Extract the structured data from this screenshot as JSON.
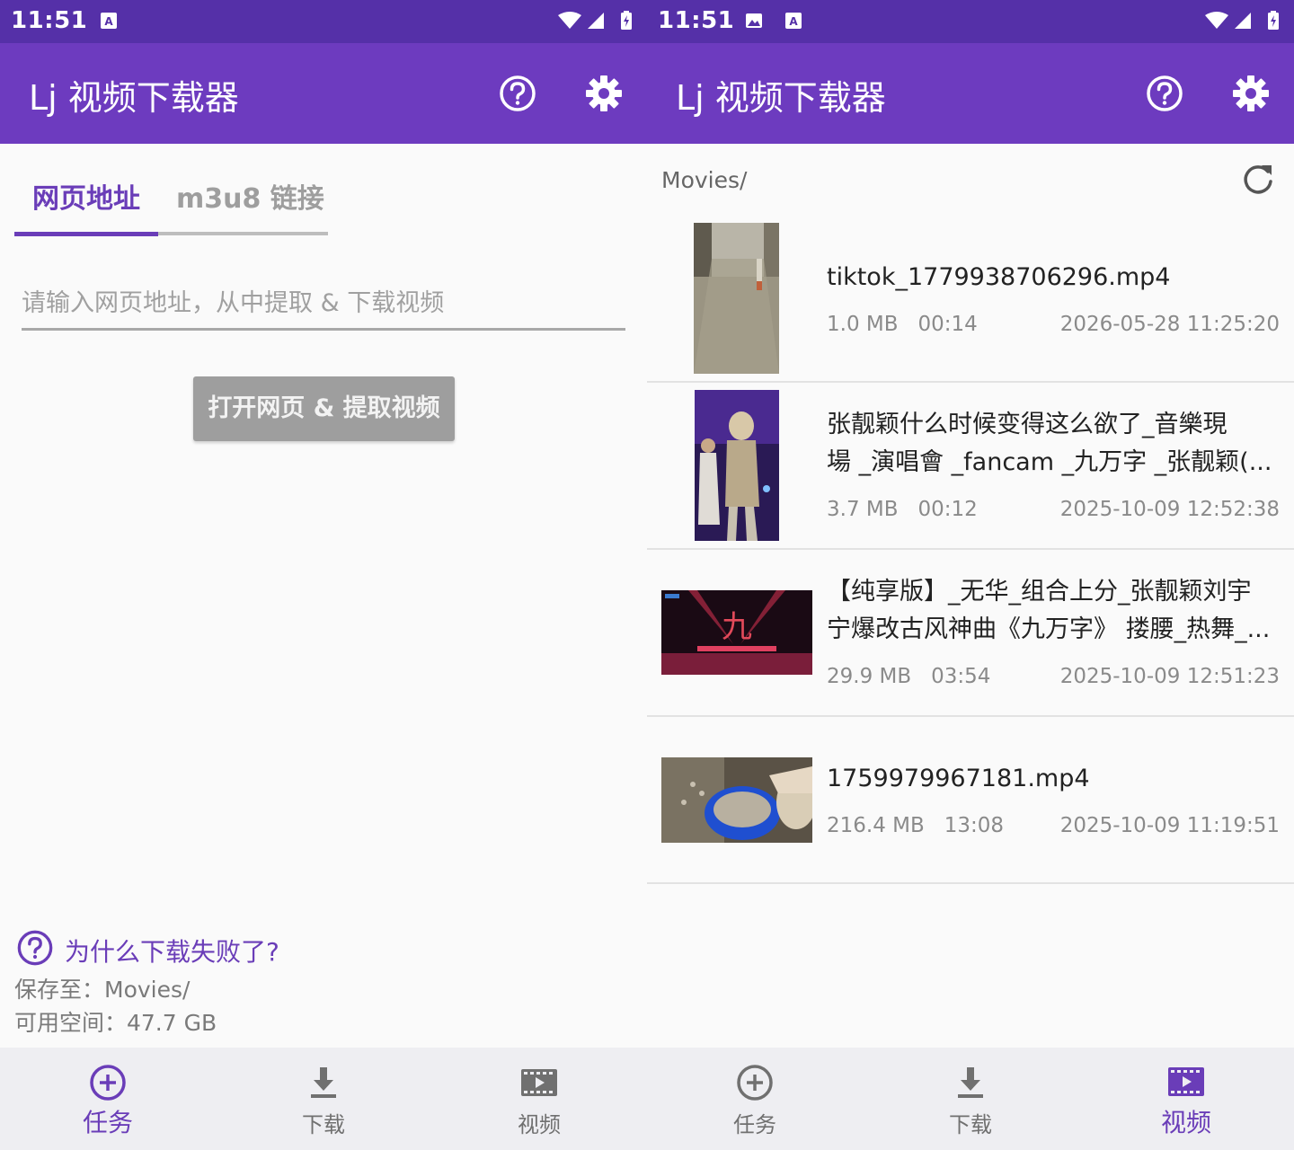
{
  "left": {
    "status": {
      "time": "11:51"
    },
    "appbar": {
      "title": "Lj 视频下载器",
      "help_icon": "help-circle-icon",
      "settings_icon": "gear-icon"
    },
    "tabs": [
      {
        "label": "网页地址",
        "active": true
      },
      {
        "label": "m3u8 链接",
        "active": false
      }
    ],
    "url_input": {
      "placeholder": "请输入网页地址，从中提取 & 下载视频",
      "value": ""
    },
    "open_button": {
      "label": "打开网页 & 提取视频"
    },
    "help_link": {
      "label": "为什么下载失败了?"
    },
    "save_to": "保存至：Movies/",
    "free_space": "可用空间：47.7 GB",
    "nav": [
      {
        "label": "任务",
        "active": true
      },
      {
        "label": "下载",
        "active": false
      },
      {
        "label": "视频",
        "active": false
      }
    ]
  },
  "right": {
    "status": {
      "time": "11:51"
    },
    "appbar": {
      "title": "Lj 视频下载器",
      "help_icon": "help-circle-icon",
      "settings_icon": "gear-icon"
    },
    "path": "Movies/",
    "videos": [
      {
        "title": "tiktok_1779938706296.mp4",
        "title_line2": "",
        "size": "1.0 MB",
        "duration": "00:14",
        "date": "2026-05-28 11:25:20"
      },
      {
        "title": "张靓颖什么时候变得这么欲了_音樂現",
        "title_line2": "場 _演唱會 _fancam _九万字 _张靓颖(...",
        "size": "3.7 MB",
        "duration": "00:12",
        "date": "2025-10-09 12:52:38"
      },
      {
        "title": "【纯享版】_无华_组合上分_张靓颖刘宇",
        "title_line2": "宁爆改古风神曲《九万字》 搂腰_热舞_...",
        "size": "29.9 MB",
        "duration": "03:54",
        "date": "2025-10-09 12:51:23"
      },
      {
        "title": "1759979967181.mp4",
        "title_line2": "",
        "size": "216.4 MB",
        "duration": "13:08",
        "date": "2025-10-09 11:19:51"
      }
    ],
    "nav": [
      {
        "label": "任务",
        "active": false
      },
      {
        "label": "下载",
        "active": false
      },
      {
        "label": "视频",
        "active": true
      }
    ]
  },
  "colors": {
    "status_bar": "#5530a8",
    "app_bar": "#6d3bbf",
    "accent": "#6a3db8",
    "disabled_button": "#9e9e9e"
  }
}
